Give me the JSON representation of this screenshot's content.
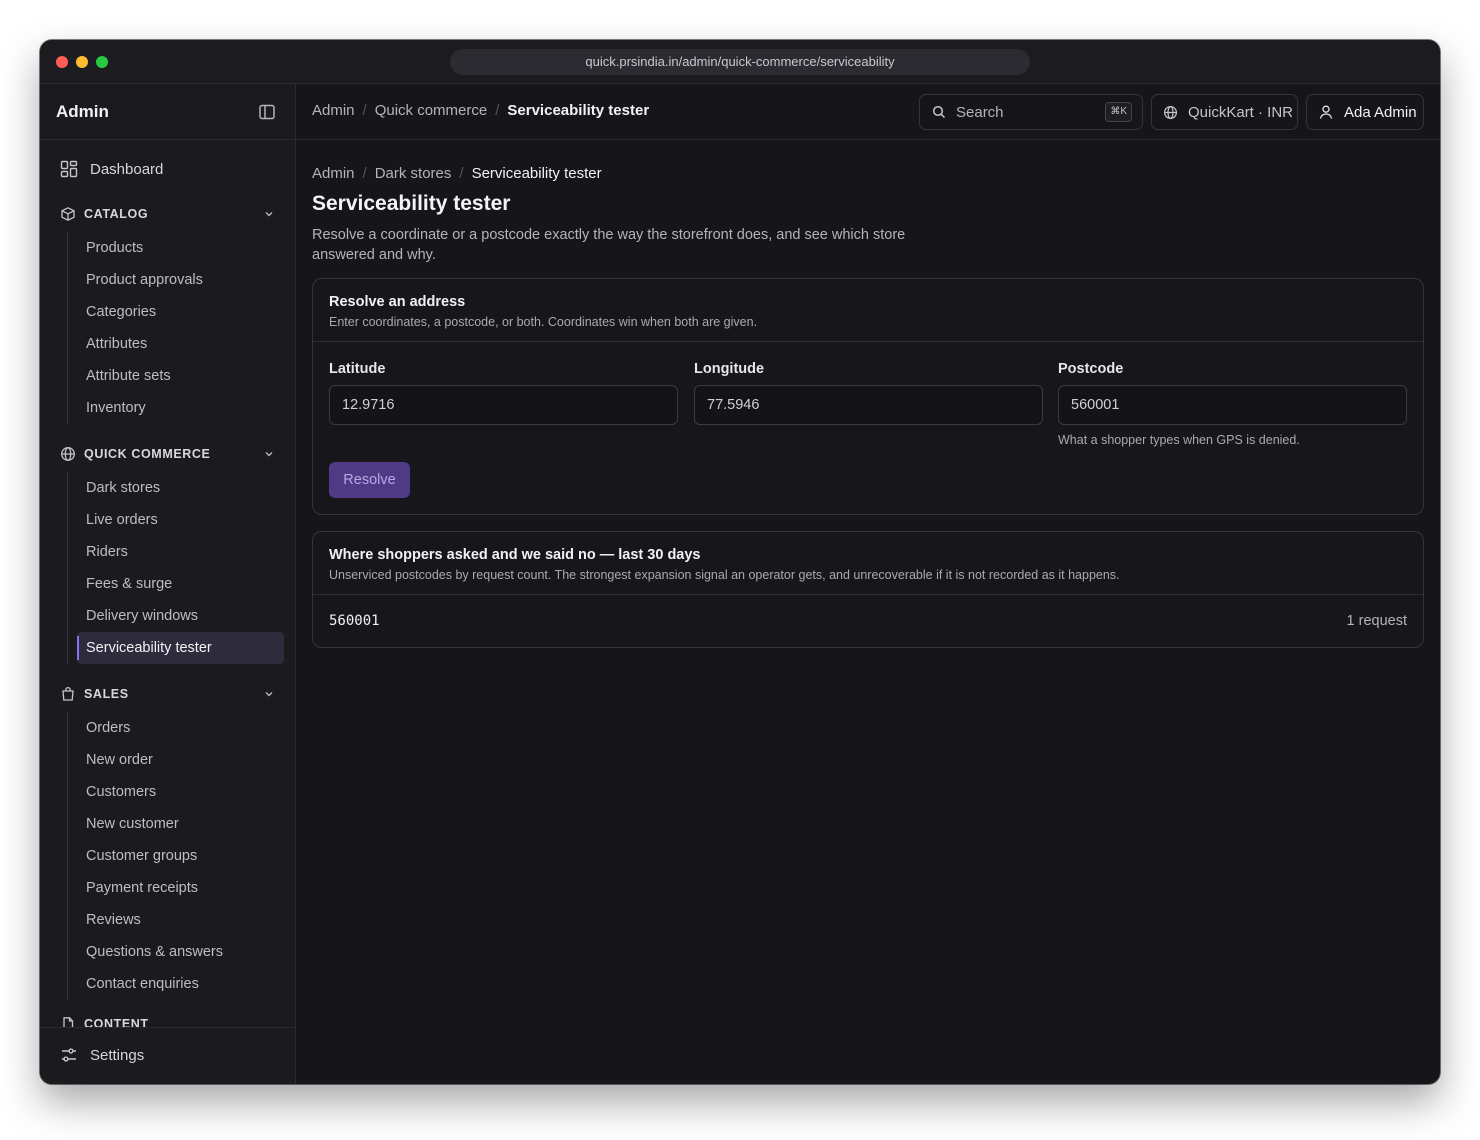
{
  "browser": {
    "url": "quick.prsindia.in/admin/quick-commerce/serviceability"
  },
  "sidebar": {
    "title": "Admin",
    "dashboard": "Dashboard",
    "groups": [
      {
        "label": "CATALOG",
        "items": [
          "Products",
          "Product approvals",
          "Categories",
          "Attributes",
          "Attribute sets",
          "Inventory"
        ]
      },
      {
        "label": "QUICK COMMERCE",
        "items": [
          "Dark stores",
          "Live orders",
          "Riders",
          "Fees & surge",
          "Delivery windows",
          "Serviceability tester"
        ],
        "active": "Serviceability tester"
      },
      {
        "label": "SALES",
        "items": [
          "Orders",
          "New order",
          "Customers",
          "New customer",
          "Customer groups",
          "Payment receipts",
          "Reviews",
          "Questions & answers",
          "Contact enquiries"
        ]
      },
      {
        "label": "CONTENT",
        "items": []
      }
    ],
    "settings": "Settings"
  },
  "topbar": {
    "breadcrumb": [
      "Admin",
      "Quick commerce",
      "Serviceability tester"
    ],
    "search_placeholder": "Search",
    "search_shortcut": "⌘K",
    "store": "QuickKart · INR",
    "user": "Ada Admin"
  },
  "page": {
    "breadcrumb": [
      "Admin",
      "Dark stores",
      "Serviceability tester"
    ],
    "title": "Serviceability tester",
    "description": "Resolve a coordinate or a postcode exactly the way the storefront does, and see which store answered and why."
  },
  "resolve_card": {
    "title": "Resolve an address",
    "subtitle": "Enter coordinates, a postcode, or both. Coordinates win when both are given.",
    "latitude_label": "Latitude",
    "latitude_value": "12.9716",
    "longitude_label": "Longitude",
    "longitude_value": "77.5946",
    "postcode_label": "Postcode",
    "postcode_value": "560001",
    "postcode_hint": "What a shopper types when GPS is denied.",
    "button": "Resolve"
  },
  "unserviced_card": {
    "title": "Where shoppers asked and we said no — last 30 days",
    "subtitle": "Unserviced postcodes by request count. The strongest expansion signal an operator gets, and unrecoverable if it is not recorded as it happens.",
    "rows": [
      {
        "postcode": "560001",
        "count": "1 request"
      }
    ]
  },
  "colors": {
    "accent": "#8b6ff0",
    "button": "#4f3a86",
    "background": "#16161a",
    "sidebar": "#1b1b1f"
  }
}
